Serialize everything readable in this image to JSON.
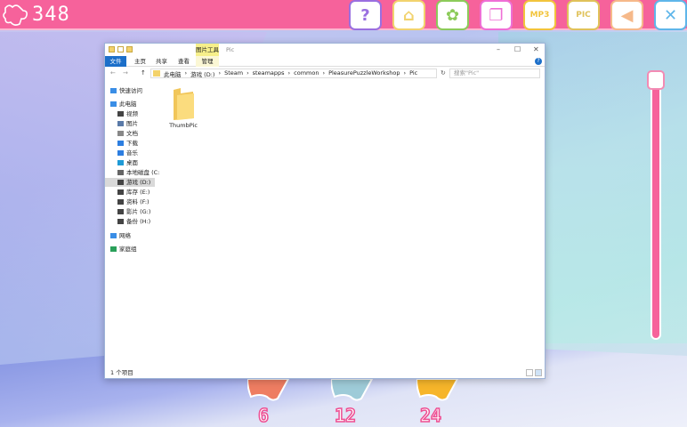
{
  "game": {
    "score": "348",
    "toolbar": [
      {
        "icon": "help-icon",
        "glyph": "?",
        "color": "#9a6fe0"
      },
      {
        "icon": "home-icon",
        "glyph": "⌂",
        "color": "#f2d36e"
      },
      {
        "icon": "gallery-icon",
        "glyph": "✿",
        "color": "#8ccb5a"
      },
      {
        "icon": "pages-icon",
        "glyph": "❐",
        "color": "#ef6fd6"
      },
      {
        "icon": "mp3-folder-icon",
        "glyph": "MP3",
        "color": "#f2c43c"
      },
      {
        "icon": "pic-folder-icon",
        "glyph": "PIC",
        "color": "#e0c25a"
      },
      {
        "icon": "sound-icon",
        "glyph": "◀",
        "color": "#f6b98a"
      },
      {
        "icon": "close-icon",
        "glyph": "✕",
        "color": "#5fb6ea"
      }
    ],
    "pieces": [
      {
        "label": "6",
        "color": "#ee7d62"
      },
      {
        "label": "12",
        "color": "#9ecbd8"
      },
      {
        "label": "24",
        "color": "#f6b52a"
      }
    ],
    "slider_value": 0,
    "accent": "#f6629b"
  },
  "explorer": {
    "context_tab": "图片工具",
    "title": "Pic",
    "tabs": [
      "文件",
      "主页",
      "共享",
      "查看",
      "管理"
    ],
    "path": [
      "此电脑",
      "游戏 (D:)",
      "Steam",
      "steamapps",
      "common",
      "PleasurePuzzleWorkshop",
      "Pic"
    ],
    "search_placeholder": "搜索\"Pic\"",
    "nav": [
      {
        "label": "快速访问"
      },
      {
        "label": "此电脑"
      },
      {
        "label": "视频"
      },
      {
        "label": "图片"
      },
      {
        "label": "文档"
      },
      {
        "label": "下载"
      },
      {
        "label": "音乐"
      },
      {
        "label": "桌面"
      },
      {
        "label": "本地磁盘 (C:"
      },
      {
        "label": "游戏 (D:)"
      },
      {
        "label": "库存 (E:)"
      },
      {
        "label": "资料 (F:)"
      },
      {
        "label": "影片 (G:)"
      },
      {
        "label": "备份 (H:)"
      },
      {
        "label": "网络"
      },
      {
        "label": "家庭组"
      }
    ],
    "items": [
      {
        "name": "ThumbPic"
      }
    ],
    "status": "1 个项目"
  }
}
